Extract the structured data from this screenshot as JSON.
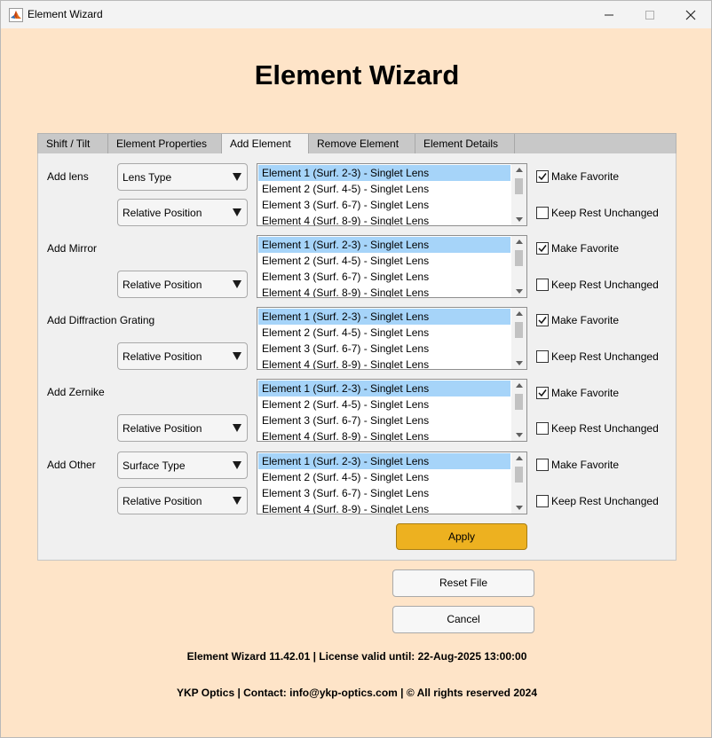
{
  "window": {
    "title": "Element Wizard",
    "accent_color": "#edb120",
    "background_color": "#fee4c8"
  },
  "heading": "Element Wizard",
  "tabs": [
    {
      "label": "Shift / Tilt",
      "active": false
    },
    {
      "label": "Element Properties",
      "active": false
    },
    {
      "label": "Add Element",
      "active": true
    },
    {
      "label": "Remove Element",
      "active": false
    },
    {
      "label": "Element Details",
      "active": false
    }
  ],
  "list_items": [
    "Element 1 (Surf. 2-3) - Singlet Lens",
    "Element 2 (Surf. 4-5) - Singlet Lens",
    "Element 3 (Surf. 6-7) - Singlet Lens",
    "Element 4 (Surf. 8-9) - Singlet Lens"
  ],
  "rows": [
    {
      "label": "Add lens",
      "type_dropdown": "Lens Type",
      "position_dropdown": "Relative Position",
      "selected_item": "Element 1 (Surf. 2-3) - Singlet Lens",
      "make_favorite_label": "Make Favorite",
      "make_favorite_checked": true,
      "keep_rest_label": "Keep Rest Unchanged",
      "keep_rest_checked": false
    },
    {
      "label": "Add Mirror",
      "type_dropdown": "",
      "position_dropdown": "Relative Position",
      "selected_item": "Element 1 (Surf. 2-3) - Singlet Lens",
      "make_favorite_label": "Make Favorite",
      "make_favorite_checked": true,
      "keep_rest_label": "Keep Rest Unchanged",
      "keep_rest_checked": false
    },
    {
      "label": "Add Diffraction Grating",
      "type_dropdown": "",
      "position_dropdown": "Relative Position",
      "selected_item": "Element 1 (Surf. 2-3) - Singlet Lens",
      "make_favorite_label": "Make Favorite",
      "make_favorite_checked": true,
      "keep_rest_label": "Keep Rest Unchanged",
      "keep_rest_checked": false
    },
    {
      "label": "Add Zernike",
      "type_dropdown": "",
      "position_dropdown": "Relative Position",
      "selected_item": "Element 1 (Surf. 2-3) - Singlet Lens",
      "make_favorite_label": "Make Favorite",
      "make_favorite_checked": true,
      "keep_rest_label": "Keep Rest Unchanged",
      "keep_rest_checked": false
    },
    {
      "label": "Add Other",
      "type_dropdown": "Surface Type",
      "position_dropdown": "Relative Position",
      "selected_item": "Element 1 (Surf. 2-3) - Singlet Lens",
      "make_favorite_label": "Make Favorite",
      "make_favorite_checked": false,
      "keep_rest_label": "Keep Rest Unchanged",
      "keep_rest_checked": false
    }
  ],
  "buttons": {
    "apply": "Apply",
    "reset_file": "Reset File",
    "cancel": "Cancel"
  },
  "footer": {
    "version_line": "Element Wizard 11.42.01 | License valid until: 22-Aug-2025 13:00:00",
    "company_line": "YKP Optics | Contact: info@ykp-optics.com | © All rights reserved 2024"
  }
}
